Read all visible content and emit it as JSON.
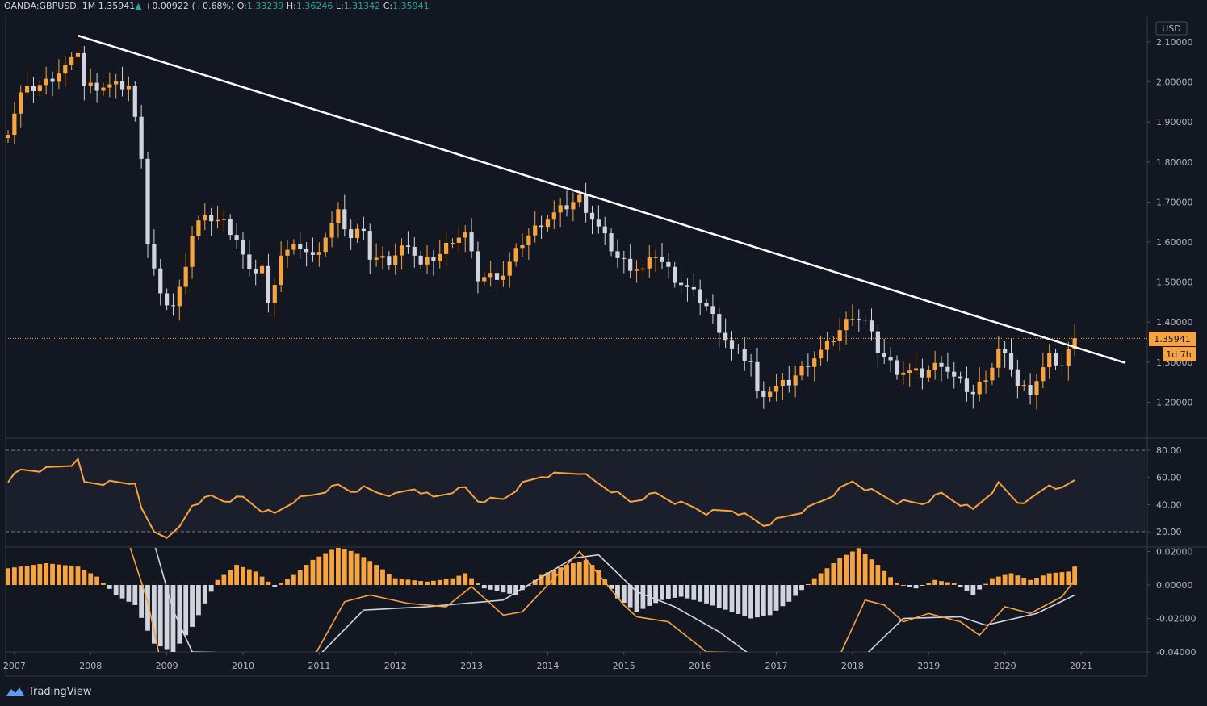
{
  "header": {
    "symbol": "OANDA:GBPUSD",
    "interval": "1M",
    "last": "1.35941",
    "change_arrow": "▲",
    "change": "+0.00922",
    "change_pct": "(+0.68%)",
    "o_label": "O:",
    "o_val": "1.33239",
    "h_label": "H:",
    "h_val": "1.36246",
    "l_label": "L:",
    "l_val": "1.31342",
    "c_label": "C:",
    "c_val": "1.35941"
  },
  "currency_label": "USD",
  "price_badge": "1.35941",
  "countdown_badge": "1d 7h",
  "brand": "TradingView",
  "colors": {
    "bg": "#131722",
    "up": "#f7a440",
    "down": "#d1d4dc",
    "line": "#ffffff",
    "rsi": "#f7a440",
    "macd": "#f7a440",
    "signal": "#d1d4dc",
    "grid": "#363a45",
    "text": "#b2b5be"
  },
  "chart_data": [
    {
      "type": "candlestick",
      "symbol": "OANDA:GBPUSD",
      "interval": "1M",
      "ylim": [
        1.13,
        2.15
      ],
      "y_ticks": [
        "2.10000",
        "2.00000",
        "1.90000",
        "1.80000",
        "1.70000",
        "1.60000",
        "1.50000",
        "1.40000",
        "1.30000",
        "1.20000"
      ],
      "x_ticks": [
        "2007",
        "2008",
        "2009",
        "2010",
        "2011",
        "2012",
        "2013",
        "2014",
        "2015",
        "2016",
        "2017",
        "2018",
        "2019",
        "2020",
        "2021"
      ],
      "last_price": 1.35941,
      "trendline": {
        "from": [
          "2007-11",
          2.116
        ],
        "to": [
          "2021-08",
          1.298
        ]
      },
      "close_path": [
        [
          "2006-12",
          1.88
        ],
        [
          "2007-02",
          1.97
        ],
        [
          "2007-06",
          2.0
        ],
        [
          "2007-10",
          2.05
        ],
        [
          "2007-11",
          2.08
        ],
        [
          "2007-12",
          1.99
        ],
        [
          "2008-03",
          1.99
        ],
        [
          "2008-07",
          1.99
        ],
        [
          "2008-09",
          1.82
        ],
        [
          "2008-10",
          1.6
        ],
        [
          "2008-12",
          1.46
        ],
        [
          "2009-02",
          1.44
        ],
        [
          "2009-03",
          1.48
        ],
        [
          "2009-05",
          1.62
        ],
        [
          "2009-06",
          1.65
        ],
        [
          "2009-08",
          1.66
        ],
        [
          "2009-10",
          1.65
        ],
        [
          "2009-12",
          1.61
        ],
        [
          "2010-02",
          1.52
        ],
        [
          "2010-04",
          1.54
        ],
        [
          "2010-05",
          1.44
        ],
        [
          "2010-07",
          1.57
        ],
        [
          "2010-10",
          1.59
        ],
        [
          "2010-12",
          1.56
        ],
        [
          "2011-04",
          1.67
        ],
        [
          "2011-06",
          1.61
        ],
        [
          "2011-08",
          1.64
        ],
        [
          "2011-09",
          1.56
        ],
        [
          "2011-12",
          1.55
        ],
        [
          "2012-03",
          1.6
        ],
        [
          "2012-05",
          1.54
        ],
        [
          "2012-08",
          1.57
        ],
        [
          "2012-10",
          1.61
        ],
        [
          "2012-12",
          1.62
        ],
        [
          "2013-02",
          1.51
        ],
        [
          "2013-06",
          1.52
        ],
        [
          "2013-09",
          1.6
        ],
        [
          "2013-12",
          1.65
        ],
        [
          "2014-06",
          1.71
        ],
        [
          "2014-08",
          1.66
        ],
        [
          "2014-12",
          1.56
        ],
        [
          "2015-02",
          1.54
        ],
        [
          "2015-04",
          1.53
        ],
        [
          "2015-06",
          1.57
        ],
        [
          "2015-09",
          1.51
        ],
        [
          "2015-12",
          1.47
        ],
        [
          "2016-02",
          1.44
        ],
        [
          "2016-06",
          1.33
        ],
        [
          "2016-09",
          1.3
        ],
        [
          "2016-10",
          1.22
        ],
        [
          "2016-12",
          1.23
        ],
        [
          "2017-03",
          1.25
        ],
        [
          "2017-06",
          1.3
        ],
        [
          "2017-09",
          1.34
        ],
        [
          "2018-01",
          1.42
        ],
        [
          "2018-03",
          1.4
        ],
        [
          "2018-05",
          1.33
        ],
        [
          "2018-08",
          1.28
        ],
        [
          "2018-12",
          1.27
        ],
        [
          "2019-03",
          1.3
        ],
        [
          "2019-05",
          1.26
        ],
        [
          "2019-08",
          1.22
        ],
        [
          "2019-11",
          1.29
        ],
        [
          "2019-12",
          1.33
        ],
        [
          "2020-02",
          1.29
        ],
        [
          "2020-03",
          1.24
        ],
        [
          "2020-05",
          1.23
        ],
        [
          "2020-08",
          1.31
        ],
        [
          "2020-10",
          1.29
        ],
        [
          "2020-12",
          1.36
        ]
      ]
    },
    {
      "type": "line",
      "name": "RSI",
      "ylim": [
        15,
        88
      ],
      "y_ticks": [
        "80.00",
        "60.00",
        "40.00",
        "20.00"
      ],
      "bands": [
        80,
        20
      ],
      "points": [
        [
          "2006-12",
          58
        ],
        [
          "2007-02",
          65
        ],
        [
          "2007-06",
          66
        ],
        [
          "2007-10",
          70
        ],
        [
          "2007-11",
          72
        ],
        [
          "2007-12",
          56
        ],
        [
          "2008-07",
          56
        ],
        [
          "2008-08",
          57
        ],
        [
          "2008-09",
          36
        ],
        [
          "2008-11",
          20
        ],
        [
          "2009-01",
          17
        ],
        [
          "2009-02",
          18
        ],
        [
          "2009-03",
          23
        ],
        [
          "2009-05",
          40
        ],
        [
          "2009-08",
          46
        ],
        [
          "2009-10",
          43
        ],
        [
          "2010-01",
          45
        ],
        [
          "2010-04",
          36
        ],
        [
          "2010-06",
          33
        ],
        [
          "2010-09",
          43
        ],
        [
          "2010-12",
          47
        ],
        [
          "2011-04",
          54
        ],
        [
          "2011-06",
          50
        ],
        [
          "2011-08",
          52
        ],
        [
          "2011-10",
          49
        ],
        [
          "2012-01",
          47
        ],
        [
          "2012-04",
          52
        ],
        [
          "2012-07",
          45
        ],
        [
          "2012-10",
          50
        ],
        [
          "2012-12",
          52
        ],
        [
          "2013-02",
          43
        ],
        [
          "2013-06",
          44
        ],
        [
          "2013-09",
          55
        ],
        [
          "2013-12",
          61
        ],
        [
          "2014-06",
          64
        ],
        [
          "2014-08",
          58
        ],
        [
          "2014-12",
          48
        ],
        [
          "2015-02",
          42
        ],
        [
          "2015-06",
          48
        ],
        [
          "2015-09",
          42
        ],
        [
          "2015-12",
          38
        ],
        [
          "2016-02",
          34
        ],
        [
          "2016-06",
          36
        ],
        [
          "2016-09",
          30
        ],
        [
          "2016-11",
          25
        ],
        [
          "2017-02",
          30
        ],
        [
          "2017-06",
          37
        ],
        [
          "2017-09",
          45
        ],
        [
          "2018-01",
          57
        ],
        [
          "2018-03",
          52
        ],
        [
          "2018-05",
          48
        ],
        [
          "2018-08",
          42
        ],
        [
          "2018-12",
          41
        ],
        [
          "2019-03",
          48
        ],
        [
          "2019-05",
          43
        ],
        [
          "2019-08",
          36
        ],
        [
          "2019-11",
          50
        ],
        [
          "2019-12",
          55
        ],
        [
          "2020-03",
          42
        ],
        [
          "2020-05",
          43
        ],
        [
          "2020-08",
          55
        ],
        [
          "2020-10",
          51
        ],
        [
          "2020-12",
          58
        ]
      ]
    },
    {
      "type": "bar+line",
      "name": "MACD",
      "ylim": [
        -0.04,
        0.021
      ],
      "y_ticks": [
        "0.02000",
        "0.00000",
        "-0.02000",
        "-0.04000"
      ],
      "histogram": [
        [
          "2006-12",
          0.01
        ],
        [
          "2007-06",
          0.013
        ],
        [
          "2007-11",
          0.011
        ],
        [
          "2008-02",
          0.005
        ],
        [
          "2008-05",
          -0.006
        ],
        [
          "2008-08",
          -0.012
        ],
        [
          "2008-11",
          -0.035
        ],
        [
          "2009-02",
          -0.04
        ],
        [
          "2009-05",
          -0.025
        ],
        [
          "2009-09",
          0.003
        ],
        [
          "2009-12",
          0.012
        ],
        [
          "2010-03",
          0.008
        ],
        [
          "2010-06",
          -0.001
        ],
        [
          "2010-09",
          0.006
        ],
        [
          "2010-12",
          0.015
        ],
        [
          "2011-04",
          0.023
        ],
        [
          "2011-07",
          0.019
        ],
        [
          "2011-10",
          0.012
        ],
        [
          "2012-01",
          0.004
        ],
        [
          "2012-06",
          0.002
        ],
        [
          "2012-10",
          0.004
        ],
        [
          "2012-12",
          0.007
        ],
        [
          "2013-03",
          -0.002
        ],
        [
          "2013-08",
          -0.006
        ],
        [
          "2013-12",
          0.006
        ],
        [
          "2014-04",
          0.012
        ],
        [
          "2014-07",
          0.015
        ],
        [
          "2014-09",
          0.009
        ],
        [
          "2014-12",
          -0.008
        ],
        [
          "2015-03",
          -0.016
        ],
        [
          "2015-07",
          -0.009
        ],
        [
          "2015-10",
          -0.007
        ],
        [
          "2016-02",
          -0.011
        ],
        [
          "2016-06",
          -0.016
        ],
        [
          "2016-09",
          -0.02
        ],
        [
          "2016-12",
          -0.018
        ],
        [
          "2017-03",
          -0.01
        ],
        [
          "2017-07",
          0.004
        ],
        [
          "2017-11",
          0.016
        ],
        [
          "2018-02",
          0.022
        ],
        [
          "2018-05",
          0.012
        ],
        [
          "2018-08",
          0.001
        ],
        [
          "2018-11",
          -0.002
        ],
        [
          "2019-02",
          0.003
        ],
        [
          "2019-05",
          0.001
        ],
        [
          "2019-08",
          -0.006
        ],
        [
          "2019-11",
          0.004
        ],
        [
          "2020-02",
          0.007
        ],
        [
          "2020-05",
          0.003
        ],
        [
          "2020-08",
          0.007
        ],
        [
          "2020-11",
          0.008
        ],
        [
          "2020-12",
          0.011
        ]
      ],
      "macd_line": [
        [
          "2008-07",
          0.025
        ],
        [
          "2008-10",
          -0.01
        ],
        [
          "2008-12",
          -0.045
        ],
        [
          "2010-12",
          -0.044
        ],
        [
          "2011-05",
          -0.01
        ],
        [
          "2011-09",
          -0.006
        ],
        [
          "2012-03",
          -0.011
        ],
        [
          "2012-09",
          -0.013
        ],
        [
          "2013-01",
          -0.001
        ],
        [
          "2013-06",
          -0.018
        ],
        [
          "2013-09",
          -0.016
        ],
        [
          "2014-06",
          0.02
        ],
        [
          "2015-01",
          -0.012
        ],
        [
          "2015-03",
          -0.019
        ],
        [
          "2015-08",
          -0.022
        ],
        [
          "2016-02",
          -0.04
        ],
        [
          "2017-11",
          -0.042
        ],
        [
          "2018-03",
          -0.009
        ],
        [
          "2018-06",
          -0.012
        ],
        [
          "2018-09",
          -0.022
        ],
        [
          "2019-01",
          -0.017
        ],
        [
          "2019-06",
          -0.022
        ],
        [
          "2019-09",
          -0.03
        ],
        [
          "2020-01",
          -0.013
        ],
        [
          "2020-05",
          -0.017
        ],
        [
          "2020-10",
          -0.007
        ],
        [
          "2020-12",
          0.003
        ]
      ],
      "signal_line": [
        [
          "2008-11",
          0.025
        ],
        [
          "2009-02",
          -0.015
        ],
        [
          "2009-05",
          -0.04
        ],
        [
          "2011-01",
          -0.042
        ],
        [
          "2011-08",
          -0.015
        ],
        [
          "2012-06",
          -0.013
        ],
        [
          "2013-06",
          -0.009
        ],
        [
          "2014-05",
          0.016
        ],
        [
          "2014-09",
          0.018
        ],
        [
          "2015-03",
          -0.004
        ],
        [
          "2015-09",
          -0.013
        ],
        [
          "2016-04",
          -0.028
        ],
        [
          "2016-09",
          -0.042
        ],
        [
          "2018-03",
          -0.042
        ],
        [
          "2018-09",
          -0.02
        ],
        [
          "2019-06",
          -0.019
        ],
        [
          "2019-10",
          -0.024
        ],
        [
          "2020-06",
          -0.017
        ],
        [
          "2020-12",
          -0.006
        ]
      ]
    }
  ]
}
